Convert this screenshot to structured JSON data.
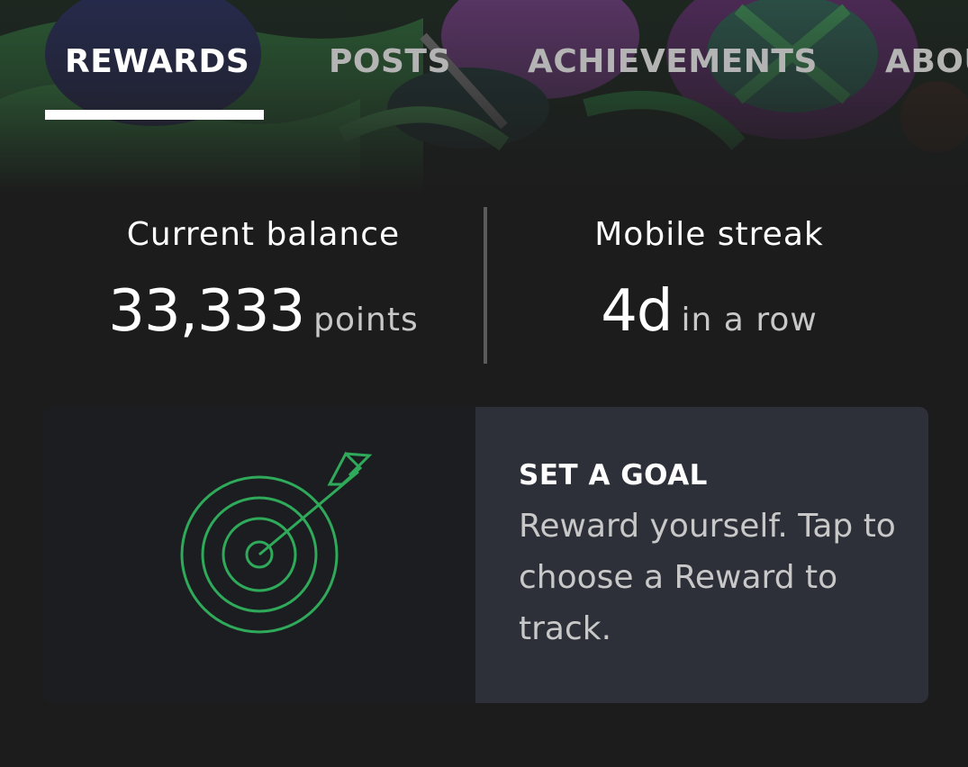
{
  "tabs": [
    {
      "label": "REWARDS",
      "active": true
    },
    {
      "label": "POSTS",
      "active": false
    },
    {
      "label": "ACHIEVEMENTS",
      "active": false
    },
    {
      "label": "ABOU",
      "active": false
    }
  ],
  "stats": {
    "balance": {
      "label": "Current balance",
      "value": "33,333",
      "unit": "points"
    },
    "streak": {
      "label": "Mobile streak",
      "value": "4d",
      "unit": "in a row"
    }
  },
  "goal_card": {
    "title": "SET A GOAL",
    "description": "Reward yourself. Tap to choose a Reward to track.",
    "icon": "target-arrow-icon",
    "icon_color": "#2faa5a"
  },
  "colors": {
    "background": "#1c1c1c",
    "card_text_panel": "#2d3038",
    "accent_green": "#2faa5a"
  }
}
